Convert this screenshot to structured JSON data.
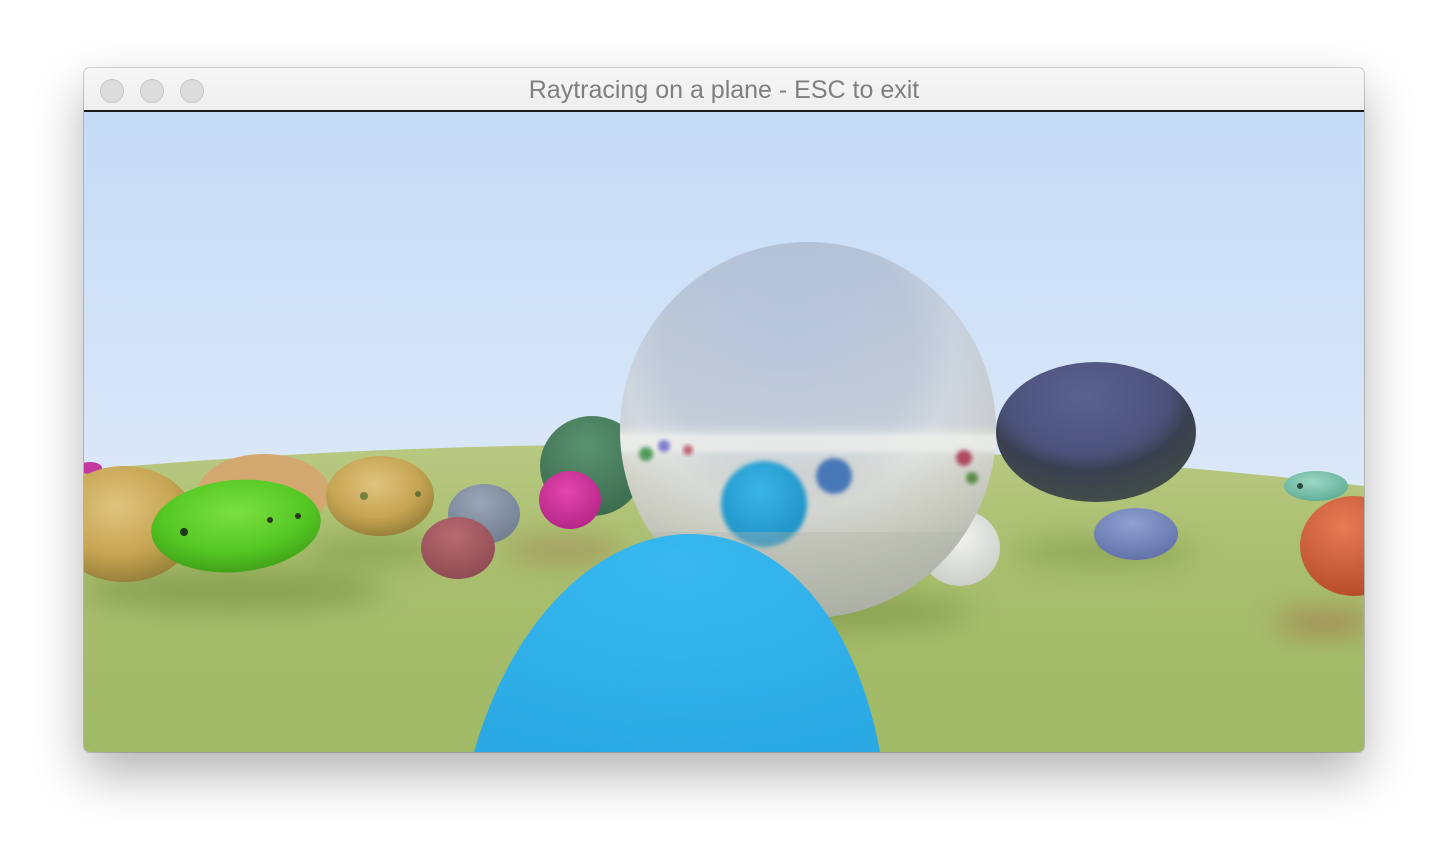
{
  "window": {
    "title": "Raytracing on a plane - ESC to exit",
    "controls": {
      "close": "close-button",
      "minimize": "minimize-button",
      "zoom": "zoom-button"
    }
  },
  "scene": {
    "sky_top": "#c5dcf6",
    "sky_horizon": "#e4eefa",
    "ground_color": "#a4bd6a",
    "spheres": [
      {
        "name": "sphere-mirror-large",
        "color": "#c8ccd4",
        "material": "metal"
      },
      {
        "name": "sphere-blue-foreground",
        "color": "#34b5ee",
        "material": "diffuse"
      },
      {
        "name": "sphere-navy-right",
        "color": "#4e5680",
        "material": "metal"
      },
      {
        "name": "sphere-green-metal-left",
        "color": "#55c92a",
        "material": "metal"
      },
      {
        "name": "sphere-gold-left",
        "color": "#c9a653",
        "material": "metal"
      },
      {
        "name": "sphere-orange-right-edge",
        "color": "#d05a38",
        "material": "diffuse"
      },
      {
        "name": "sphere-magenta",
        "color": "#d9349f",
        "material": "diffuse"
      },
      {
        "name": "sphere-dark-green",
        "color": "#4a8060",
        "material": "diffuse"
      },
      {
        "name": "sphere-white",
        "color": "#e6e8e6",
        "material": "diffuse"
      },
      {
        "name": "sphere-teal-far-right",
        "color": "#7ec6b2",
        "material": "metal"
      }
    ]
  }
}
